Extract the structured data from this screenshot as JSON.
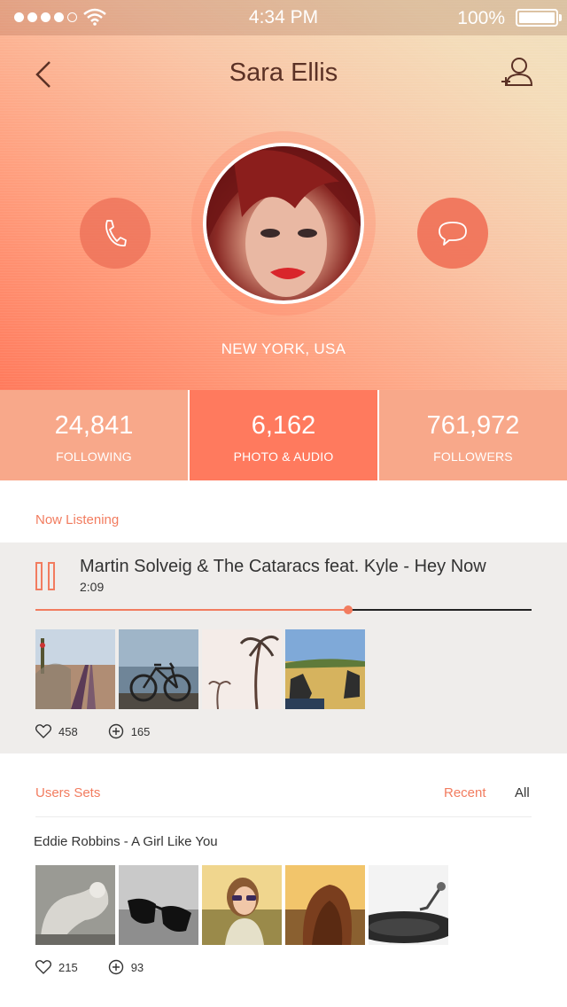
{
  "status_bar": {
    "time": "4:34 PM",
    "battery": "100%"
  },
  "header": {
    "title": "Sara Ellis",
    "location": "NEW YORK, USA"
  },
  "stats": [
    {
      "value": "24,841",
      "label": "FOLLOWING"
    },
    {
      "value": "6,162",
      "label": "PHOTO & AUDIO"
    },
    {
      "value": "761,972",
      "label": "FOLLOWERS"
    }
  ],
  "now_listening": {
    "label": "Now Listening",
    "track": "Martin Solveig & The Cataracs feat. Kyle - Hey Now",
    "time": "2:09",
    "progress": 0.63,
    "likes": "458",
    "adds": "165"
  },
  "users_sets": {
    "label": "Users Sets",
    "tab_recent": "Recent",
    "tab_all": "All",
    "set_title": "Eddie Robbins - A Girl Like You",
    "likes": "215",
    "adds": "93"
  },
  "colors": {
    "accent": "#f27c5f",
    "stat": "#f8a88a",
    "stat_active": "#ff7a5e"
  }
}
